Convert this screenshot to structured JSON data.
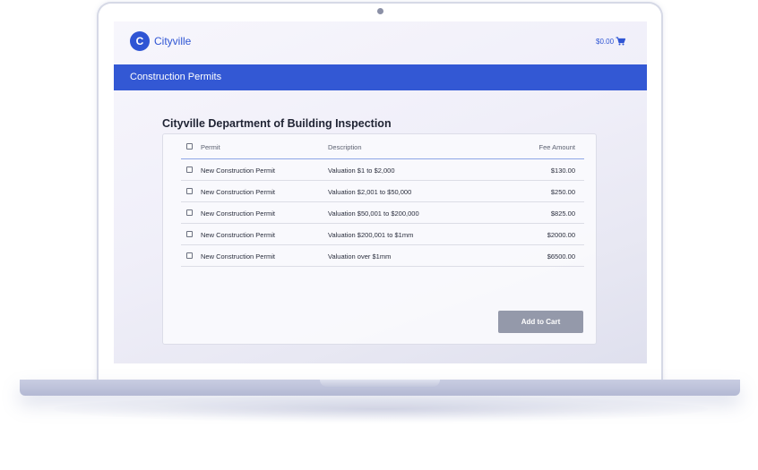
{
  "app": {
    "logo_letter": "C",
    "brand_name": "Cityville",
    "cart_amount": "$0.00"
  },
  "nav": {
    "title": "Construction Permits"
  },
  "page": {
    "heading": "Cityville Department of Building Inspection"
  },
  "table": {
    "columns": [
      "Permit",
      "Description",
      "Fee Amount"
    ],
    "rows": [
      {
        "permit": "New Construction Permit",
        "description": "Valuation $1 to $2,000",
        "fee": "$130.00"
      },
      {
        "permit": "New Construction Permit",
        "description": "Valuation $2,001 to $50,000",
        "fee": "$250.00"
      },
      {
        "permit": "New Construction Permit",
        "description": "Valuation $50,001 to $200,000",
        "fee": "$825.00"
      },
      {
        "permit": "New Construction Permit",
        "description": "Valuation $200,001 to $1mm",
        "fee": "$2000.00"
      },
      {
        "permit": "New Construction Permit",
        "description": "Valuation over $1mm",
        "fee": "$6500.00"
      }
    ]
  },
  "actions": {
    "add_to_cart_label": "Add to Cart"
  },
  "colors": {
    "brand_blue": "#3358d4",
    "button_disabled": "#9499aa"
  },
  "icons": {
    "cart": "cart-icon",
    "checkbox": "checkbox-icon"
  }
}
